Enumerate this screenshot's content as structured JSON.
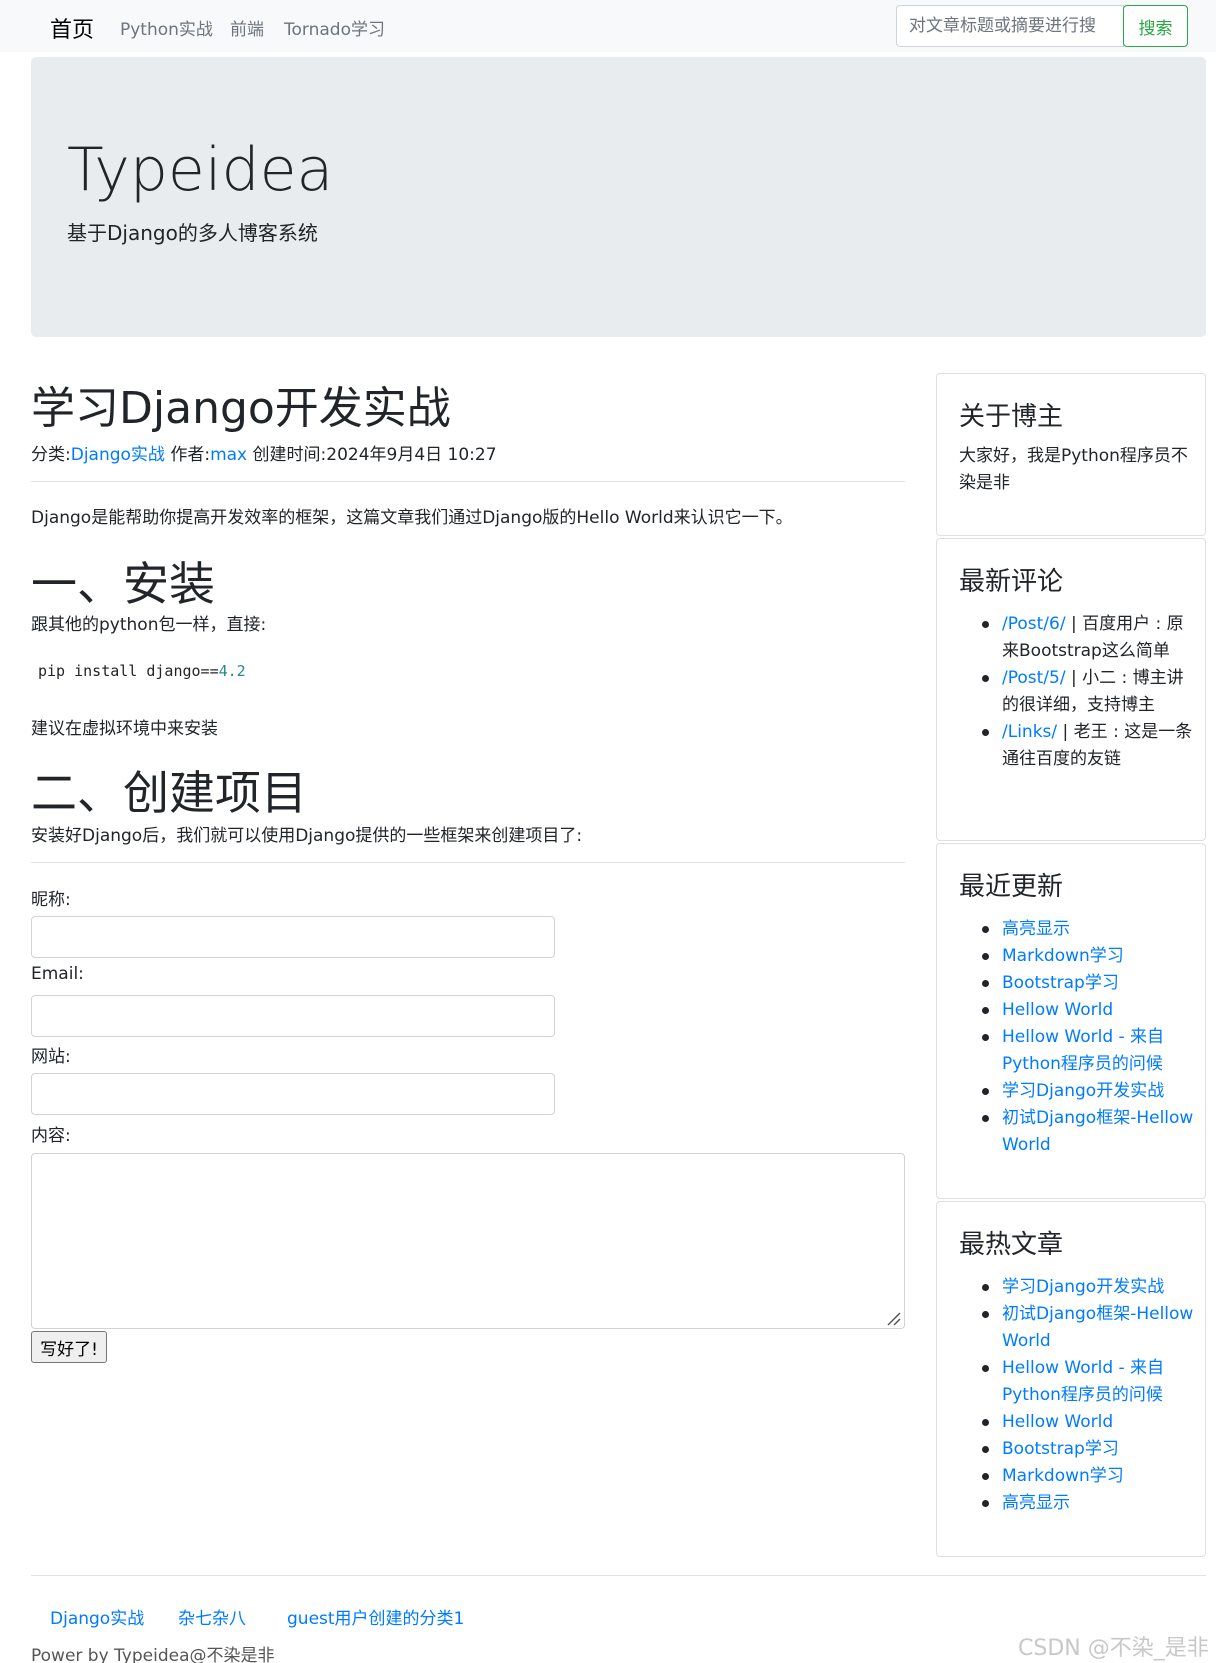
{
  "nav": {
    "brand": "首页",
    "links": [
      "Python实战",
      "前端",
      "Tornado学习"
    ],
    "search_placeholder": "对文章标题或摘要进行搜",
    "search_button": "搜索"
  },
  "jumbotron": {
    "title": "Typeidea",
    "subtitle": "基于Django的多人博客系统"
  },
  "post": {
    "title": "学习Django开发实战",
    "meta": {
      "category_label": "分类:",
      "category": "Django实战",
      "author_label": " 作者:",
      "author": "max",
      "created": " 创建时间:2024年9月4日 10:27"
    },
    "intro": "Django是能帮助你提高开发效率的框架，这篇文章我们通过Django版的Hello World来认识它一下。",
    "section1": {
      "heading": "一、安装",
      "text": "跟其他的python包一样，直接:",
      "code_cmd": "pip install django==",
      "code_version": "4.2",
      "note": "建议在虚拟环境中来安装"
    },
    "section2": {
      "heading": "二、创建项目",
      "text": "安装好Django后，我们就可以使用Django提供的一些框架来创建项目了:"
    }
  },
  "comment_form": {
    "nickname_label": "昵称:",
    "email_label": "Email:",
    "website_label": "网站:",
    "content_label": "内容:",
    "submit_label": "写好了!"
  },
  "sidebar": {
    "about": {
      "title": "关于博主",
      "text": "大家好，我是Python程序员不染是非"
    },
    "comments": {
      "title": "最新评论",
      "items": [
        {
          "link": "/Post/6/",
          "text": " | 百度用户 : 原来Bootstrap这么简单"
        },
        {
          "link": "/Post/5/",
          "text": " | 小二 : 博主讲的很详细，支持博主"
        },
        {
          "link": "/Links/",
          "text": " | 老王 : 这是一条通往百度的友链"
        }
      ]
    },
    "latest": {
      "title": "最近更新",
      "items": [
        "高亮显示",
        "Markdown学习",
        "Bootstrap学习",
        "Hellow World",
        "Hellow World - 来自Python程序员的问候",
        "学习Django开发实战",
        "初试Django框架-Hellow World"
      ]
    },
    "hot": {
      "title": "最热文章",
      "items": [
        "学习Django开发实战",
        "初试Django框架-Hellow World",
        "Hellow World - 来自Python程序员的问候",
        "Hellow World",
        "Bootstrap学习",
        "Markdown学习",
        "高亮显示"
      ]
    }
  },
  "footer": {
    "categories": [
      "Django实战",
      "杂七杂八",
      "guest用户创建的分类1"
    ],
    "power": "Power by Typeidea@不染是非",
    "watermark": "CSDN @不染_是非"
  }
}
